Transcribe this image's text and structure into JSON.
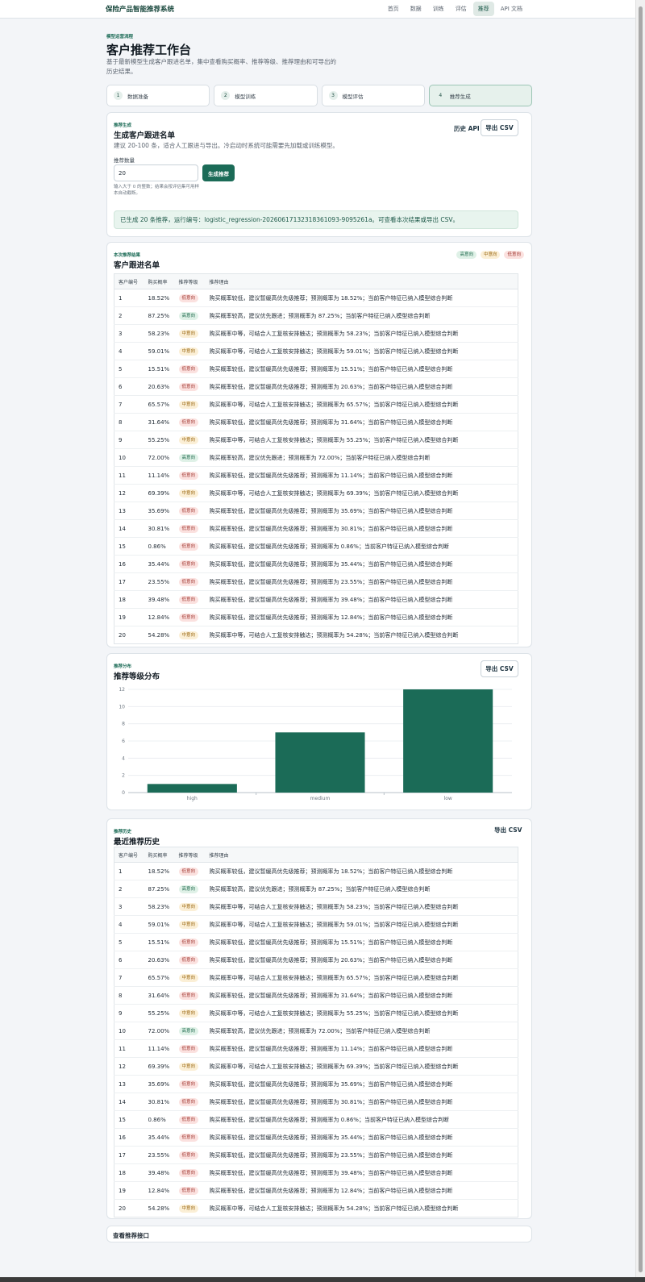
{
  "app": {
    "brand": "保险产品智能推荐系统"
  },
  "nav": [
    "首页",
    "数据",
    "训练",
    "评估",
    "推荐",
    "API 文档"
  ],
  "nav_active": 4,
  "hero": {
    "eyebrow": "模型运营流程",
    "title": "客户推荐工作台",
    "description": "基于最新模型生成客户跟进名单，集中查看购买概率、推荐等级、推荐理由和可导出的历史结果。"
  },
  "steps": [
    {
      "num": "1",
      "label": "数据准备"
    },
    {
      "num": "2",
      "label": "模型训练"
    },
    {
      "num": "3",
      "label": "模型评估"
    },
    {
      "num": "4",
      "label": "推荐生成"
    }
  ],
  "active_step": 3,
  "generate": {
    "eyebrow": "推荐生成",
    "title": "生成客户跟进名单",
    "description": "建议 20-100 条，适合人工跟进与导出。冷启动时系统可能需要先加载或训练模型。",
    "history_api": "历史 API",
    "export_csv": "导出 CSV",
    "count_label": "推荐数量",
    "count_value": "20",
    "button": "生成推荐",
    "hint": "输入大于 0 的整数；结果会按评估集可用样本自动截断。",
    "success": "已生成 20 条推荐，运行编号：logistic_regression-20260617132318361093-9095261a。可查看本次结果或导出 CSV。"
  },
  "result": {
    "eyebrow": "本次推荐结果",
    "title": "客户跟进名单",
    "legend": {
      "high": "高意向",
      "medium": "中意向",
      "low": "低意向"
    }
  },
  "table_headers": [
    "客户编号",
    "购买概率",
    "推荐等级",
    "推荐理由"
  ],
  "rows": [
    {
      "id": "1",
      "prob": "18.52%",
      "level": "low",
      "label": "低意向",
      "reason": "购买概率较低，建议暂缓高优先级推荐；预测概率为 18.52%；当前客户特征已纳入模型综合判断"
    },
    {
      "id": "2",
      "prob": "87.25%",
      "level": "high",
      "label": "高意向",
      "reason": "购买概率较高，建议优先跟进；预测概率为 87.25%；当前客户特征已纳入模型综合判断"
    },
    {
      "id": "3",
      "prob": "58.23%",
      "level": "medium",
      "label": "中意向",
      "reason": "购买概率中等，可结合人工复核安排触达；预测概率为 58.23%；当前客户特征已纳入模型综合判断"
    },
    {
      "id": "4",
      "prob": "59.01%",
      "level": "medium",
      "label": "中意向",
      "reason": "购买概率中等，可结合人工复核安排触达；预测概率为 59.01%；当前客户特征已纳入模型综合判断"
    },
    {
      "id": "5",
      "prob": "15.51%",
      "level": "low",
      "label": "低意向",
      "reason": "购买概率较低，建议暂缓高优先级推荐；预测概率为 15.51%；当前客户特征已纳入模型综合判断"
    },
    {
      "id": "6",
      "prob": "20.63%",
      "level": "low",
      "label": "低意向",
      "reason": "购买概率较低，建议暂缓高优先级推荐；预测概率为 20.63%；当前客户特征已纳入模型综合判断"
    },
    {
      "id": "7",
      "prob": "65.57%",
      "level": "medium",
      "label": "中意向",
      "reason": "购买概率中等，可结合人工复核安排触达；预测概率为 65.57%；当前客户特征已纳入模型综合判断"
    },
    {
      "id": "8",
      "prob": "31.64%",
      "level": "low",
      "label": "低意向",
      "reason": "购买概率较低，建议暂缓高优先级推荐；预测概率为 31.64%；当前客户特征已纳入模型综合判断"
    },
    {
      "id": "9",
      "prob": "55.25%",
      "level": "medium",
      "label": "中意向",
      "reason": "购买概率中等，可结合人工复核安排触达；预测概率为 55.25%；当前客户特征已纳入模型综合判断"
    },
    {
      "id": "10",
      "prob": "72.00%",
      "level": "high",
      "label": "高意向",
      "reason": "购买概率较高，建议优先跟进；预测概率为 72.00%；当前客户特征已纳入模型综合判断"
    },
    {
      "id": "11",
      "prob": "11.14%",
      "level": "low",
      "label": "低意向",
      "reason": "购买概率较低，建议暂缓高优先级推荐；预测概率为 11.14%；当前客户特征已纳入模型综合判断"
    },
    {
      "id": "12",
      "prob": "69.39%",
      "level": "medium",
      "label": "中意向",
      "reason": "购买概率中等，可结合人工复核安排触达；预测概率为 69.39%；当前客户特征已纳入模型综合判断"
    },
    {
      "id": "13",
      "prob": "35.69%",
      "level": "low",
      "label": "低意向",
      "reason": "购买概率较低，建议暂缓高优先级推荐；预测概率为 35.69%；当前客户特征已纳入模型综合判断"
    },
    {
      "id": "14",
      "prob": "30.81%",
      "level": "low",
      "label": "低意向",
      "reason": "购买概率较低，建议暂缓高优先级推荐；预测概率为 30.81%；当前客户特征已纳入模型综合判断"
    },
    {
      "id": "15",
      "prob": "0.86%",
      "level": "low",
      "label": "低意向",
      "reason": "购买概率较低，建议暂缓高优先级推荐；预测概率为 0.86%；当前客户特征已纳入模型综合判断"
    },
    {
      "id": "16",
      "prob": "35.44%",
      "level": "low",
      "label": "低意向",
      "reason": "购买概率较低，建议暂缓高优先级推荐；预测概率为 35.44%；当前客户特征已纳入模型综合判断"
    },
    {
      "id": "17",
      "prob": "23.55%",
      "level": "low",
      "label": "低意向",
      "reason": "购买概率较低，建议暂缓高优先级推荐；预测概率为 23.55%；当前客户特征已纳入模型综合判断"
    },
    {
      "id": "18",
      "prob": "39.48%",
      "level": "low",
      "label": "低意向",
      "reason": "购买概率较低，建议暂缓高优先级推荐；预测概率为 39.48%；当前客户特征已纳入模型综合判断"
    },
    {
      "id": "19",
      "prob": "12.84%",
      "level": "low",
      "label": "低意向",
      "reason": "购买概率较低，建议暂缓高优先级推荐；预测概率为 12.84%；当前客户特征已纳入模型综合判断"
    },
    {
      "id": "20",
      "prob": "54.28%",
      "level": "medium",
      "label": "中意向",
      "reason": "购买概率中等，可结合人工复核安排触达；预测概率为 54.28%；当前客户特征已纳入模型综合判断"
    }
  ],
  "distribution": {
    "eyebrow": "推荐分布",
    "title": "推荐等级分布",
    "export_csv": "导出 CSV"
  },
  "chart_data": {
    "type": "bar",
    "categories": [
      "high",
      "medium",
      "low"
    ],
    "values": [
      1,
      7,
      12
    ],
    "yticks": [
      0,
      2,
      4,
      6,
      8,
      10,
      12
    ],
    "ylim": [
      0,
      12
    ],
    "bar_color": "#1b6b57",
    "grid": true
  },
  "history": {
    "eyebrow": "推荐历史",
    "title": "最近推荐历史",
    "export_csv": "导出 CSV"
  },
  "api_section": {
    "title": "查看推荐接口"
  },
  "colors": {
    "brand": "#1b6b57",
    "high": "#1f6a4e",
    "medium": "#9a6711",
    "low": "#a23a33"
  }
}
